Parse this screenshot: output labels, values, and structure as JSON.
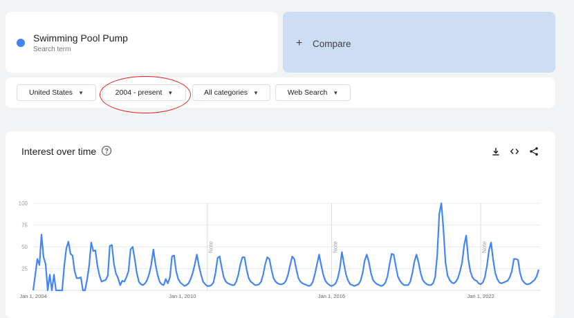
{
  "search_term": {
    "name": "Swimming Pool Pump",
    "subtitle": "Search term",
    "color": "#4285f4"
  },
  "compare": {
    "plus": "+",
    "label": "Compare"
  },
  "filters": {
    "region": "United States",
    "time_range": "2004 - present",
    "category": "All categories",
    "search_type": "Web Search"
  },
  "chart_section": {
    "title": "Interest over time",
    "icons": [
      "help-icon",
      "download-icon",
      "embed-icon",
      "share-icon"
    ]
  },
  "chart_data": {
    "type": "line",
    "title": "Interest over time",
    "xlabel": "",
    "ylabel": "",
    "ylim": [
      0,
      100
    ],
    "yticks": [
      25,
      50,
      75,
      100
    ],
    "x_range": [
      "2004-01",
      "2024-06"
    ],
    "grid": true,
    "x_tick_labels": [
      {
        "label": "Jan 1, 2004",
        "date": "2004-01"
      },
      {
        "label": "Jan 1, 2010",
        "date": "2010-01"
      },
      {
        "label": "Jan 1, 2016",
        "date": "2016-01"
      },
      {
        "label": "Jan 1, 2022",
        "date": "2022-01"
      }
    ],
    "notes": [
      {
        "label": "Note",
        "date": "2011-01"
      },
      {
        "label": "Note",
        "date": "2016-01"
      },
      {
        "label": "Note",
        "date": "2022-01"
      }
    ],
    "series": [
      {
        "name": "Swimming Pool Pump",
        "color": "#4285f4",
        "points": [
          [
            "2004-01",
            0
          ],
          [
            "2004-03",
            36
          ],
          [
            "2004-04",
            29
          ],
          [
            "2004-05",
            64
          ],
          [
            "2004-06",
            38
          ],
          [
            "2004-07",
            30
          ],
          [
            "2004-08",
            0
          ],
          [
            "2004-09",
            18
          ],
          [
            "2004-10",
            0
          ],
          [
            "2004-11",
            18
          ],
          [
            "2004-12",
            0
          ],
          [
            "2005-01",
            0
          ],
          [
            "2005-03",
            0
          ],
          [
            "2005-04",
            28
          ],
          [
            "2005-05",
            48
          ],
          [
            "2005-06",
            56
          ],
          [
            "2005-07",
            42
          ],
          [
            "2005-08",
            40
          ],
          [
            "2005-09",
            22
          ],
          [
            "2005-10",
            14
          ],
          [
            "2005-11",
            14
          ],
          [
            "2005-12",
            15
          ],
          [
            "2006-01",
            0
          ],
          [
            "2006-02",
            0
          ],
          [
            "2006-03",
            12
          ],
          [
            "2006-04",
            28
          ],
          [
            "2006-05",
            55
          ],
          [
            "2006-06",
            45
          ],
          [
            "2006-07",
            46
          ],
          [
            "2006-08",
            28
          ],
          [
            "2006-09",
            17
          ],
          [
            "2006-10",
            10
          ],
          [
            "2006-11",
            11
          ],
          [
            "2006-12",
            12
          ],
          [
            "2007-01",
            17
          ],
          [
            "2007-02",
            51
          ],
          [
            "2007-03",
            52
          ],
          [
            "2007-04",
            30
          ],
          [
            "2007-05",
            19
          ],
          [
            "2007-06",
            14
          ],
          [
            "2007-07",
            6
          ],
          [
            "2007-08",
            11
          ],
          [
            "2007-09",
            10
          ],
          [
            "2007-10",
            15
          ],
          [
            "2007-11",
            22
          ],
          [
            "2007-12",
            47
          ],
          [
            "2008-01",
            50
          ],
          [
            "2008-02",
            36
          ],
          [
            "2008-03",
            20
          ],
          [
            "2008-04",
            10
          ],
          [
            "2008-05",
            7
          ],
          [
            "2008-06",
            6
          ],
          [
            "2008-07",
            8
          ],
          [
            "2008-08",
            12
          ],
          [
            "2008-09",
            19
          ],
          [
            "2008-10",
            30
          ],
          [
            "2008-11",
            47
          ],
          [
            "2008-12",
            30
          ],
          [
            "2009-01",
            18
          ],
          [
            "2009-02",
            10
          ],
          [
            "2009-03",
            7
          ],
          [
            "2009-04",
            6
          ],
          [
            "2009-05",
            13
          ],
          [
            "2009-06",
            8
          ],
          [
            "2009-07",
            15
          ],
          [
            "2009-08",
            39
          ],
          [
            "2009-09",
            40
          ],
          [
            "2009-10",
            22
          ],
          [
            "2009-11",
            13
          ],
          [
            "2009-12",
            9
          ],
          [
            "2010-01",
            7
          ],
          [
            "2010-02",
            5
          ],
          [
            "2010-03",
            6
          ],
          [
            "2010-04",
            8
          ],
          [
            "2010-05",
            13
          ],
          [
            "2010-06",
            20
          ],
          [
            "2010-07",
            30
          ],
          [
            "2010-08",
            41
          ],
          [
            "2010-09",
            28
          ],
          [
            "2010-10",
            18
          ],
          [
            "2010-11",
            10
          ],
          [
            "2010-12",
            7
          ],
          [
            "2011-01",
            5
          ],
          [
            "2011-02",
            5
          ],
          [
            "2011-03",
            6
          ],
          [
            "2011-04",
            9
          ],
          [
            "2011-05",
            20
          ],
          [
            "2011-06",
            37
          ],
          [
            "2011-07",
            39
          ],
          [
            "2011-08",
            26
          ],
          [
            "2011-09",
            15
          ],
          [
            "2011-10",
            10
          ],
          [
            "2011-11",
            8
          ],
          [
            "2011-12",
            7
          ],
          [
            "2012-01",
            6
          ],
          [
            "2012-02",
            6
          ],
          [
            "2012-03",
            10
          ],
          [
            "2012-04",
            18
          ],
          [
            "2012-05",
            30
          ],
          [
            "2012-06",
            38
          ],
          [
            "2012-07",
            38
          ],
          [
            "2012-08",
            24
          ],
          [
            "2012-09",
            14
          ],
          [
            "2012-10",
            10
          ],
          [
            "2012-11",
            8
          ],
          [
            "2012-12",
            6
          ],
          [
            "2013-01",
            6
          ],
          [
            "2013-02",
            7
          ],
          [
            "2013-03",
            10
          ],
          [
            "2013-04",
            18
          ],
          [
            "2013-05",
            30
          ],
          [
            "2013-06",
            38
          ],
          [
            "2013-07",
            36
          ],
          [
            "2013-08",
            24
          ],
          [
            "2013-09",
            14
          ],
          [
            "2013-10",
            10
          ],
          [
            "2013-11",
            8
          ],
          [
            "2013-12",
            7
          ],
          [
            "2014-01",
            7
          ],
          [
            "2014-02",
            8
          ],
          [
            "2014-03",
            11
          ],
          [
            "2014-04",
            18
          ],
          [
            "2014-05",
            29
          ],
          [
            "2014-06",
            39
          ],
          [
            "2014-07",
            36
          ],
          [
            "2014-08",
            24
          ],
          [
            "2014-09",
            14
          ],
          [
            "2014-10",
            10
          ],
          [
            "2014-11",
            8
          ],
          [
            "2014-12",
            7
          ],
          [
            "2015-01",
            6
          ],
          [
            "2015-02",
            5
          ],
          [
            "2015-03",
            6
          ],
          [
            "2015-04",
            10
          ],
          [
            "2015-05",
            19
          ],
          [
            "2015-06",
            30
          ],
          [
            "2015-07",
            41
          ],
          [
            "2015-08",
            29
          ],
          [
            "2015-09",
            18
          ],
          [
            "2015-10",
            11
          ],
          [
            "2015-11",
            8
          ],
          [
            "2015-12",
            6
          ],
          [
            "2016-01",
            5
          ],
          [
            "2016-02",
            6
          ],
          [
            "2016-03",
            8
          ],
          [
            "2016-04",
            14
          ],
          [
            "2016-05",
            25
          ],
          [
            "2016-06",
            44
          ],
          [
            "2016-07",
            30
          ],
          [
            "2016-08",
            18
          ],
          [
            "2016-09",
            11
          ],
          [
            "2016-10",
            7
          ],
          [
            "2016-11",
            6
          ],
          [
            "2016-12",
            5
          ],
          [
            "2017-01",
            6
          ],
          [
            "2017-02",
            7
          ],
          [
            "2017-03",
            11
          ],
          [
            "2017-04",
            20
          ],
          [
            "2017-05",
            34
          ],
          [
            "2017-06",
            41
          ],
          [
            "2017-07",
            33
          ],
          [
            "2017-08",
            20
          ],
          [
            "2017-09",
            12
          ],
          [
            "2017-10",
            9
          ],
          [
            "2017-11",
            7
          ],
          [
            "2017-12",
            6
          ],
          [
            "2018-01",
            5
          ],
          [
            "2018-02",
            6
          ],
          [
            "2018-03",
            9
          ],
          [
            "2018-04",
            16
          ],
          [
            "2018-05",
            30
          ],
          [
            "2018-06",
            42
          ],
          [
            "2018-07",
            41
          ],
          [
            "2018-08",
            28
          ],
          [
            "2018-09",
            16
          ],
          [
            "2018-10",
            11
          ],
          [
            "2018-11",
            8
          ],
          [
            "2018-12",
            6
          ],
          [
            "2019-01",
            6
          ],
          [
            "2019-02",
            6
          ],
          [
            "2019-03",
            10
          ],
          [
            "2019-04",
            20
          ],
          [
            "2019-05",
            33
          ],
          [
            "2019-06",
            41
          ],
          [
            "2019-07",
            32
          ],
          [
            "2019-08",
            20
          ],
          [
            "2019-09",
            12
          ],
          [
            "2019-10",
            9
          ],
          [
            "2019-11",
            7
          ],
          [
            "2019-12",
            6
          ],
          [
            "2020-01",
            6
          ],
          [
            "2020-02",
            8
          ],
          [
            "2020-03",
            15
          ],
          [
            "2020-04",
            40
          ],
          [
            "2020-05",
            88
          ],
          [
            "2020-06",
            100
          ],
          [
            "2020-07",
            70
          ],
          [
            "2020-08",
            32
          ],
          [
            "2020-09",
            17
          ],
          [
            "2020-10",
            12
          ],
          [
            "2020-11",
            9
          ],
          [
            "2020-12",
            8
          ],
          [
            "2021-01",
            10
          ],
          [
            "2021-02",
            14
          ],
          [
            "2021-03",
            22
          ],
          [
            "2021-04",
            32
          ],
          [
            "2021-05",
            52
          ],
          [
            "2021-06",
            63
          ],
          [
            "2021-07",
            36
          ],
          [
            "2021-08",
            22
          ],
          [
            "2021-09",
            15
          ],
          [
            "2021-10",
            12
          ],
          [
            "2021-11",
            11
          ],
          [
            "2021-12",
            8
          ],
          [
            "2022-01",
            7
          ],
          [
            "2022-02",
            9
          ],
          [
            "2022-03",
            15
          ],
          [
            "2022-04",
            28
          ],
          [
            "2022-05",
            46
          ],
          [
            "2022-06",
            55
          ],
          [
            "2022-07",
            35
          ],
          [
            "2022-08",
            20
          ],
          [
            "2022-09",
            13
          ],
          [
            "2022-10",
            9
          ],
          [
            "2022-11",
            8
          ],
          [
            "2022-12",
            9
          ],
          [
            "2023-01",
            10
          ],
          [
            "2023-02",
            11
          ],
          [
            "2023-03",
            15
          ],
          [
            "2023-04",
            22
          ],
          [
            "2023-05",
            36
          ],
          [
            "2023-06",
            36
          ],
          [
            "2023-07",
            35
          ],
          [
            "2023-08",
            20
          ],
          [
            "2023-09",
            12
          ],
          [
            "2023-10",
            9
          ],
          [
            "2023-11",
            7
          ],
          [
            "2023-12",
            7
          ],
          [
            "2024-01",
            8
          ],
          [
            "2024-02",
            10
          ],
          [
            "2024-03",
            12
          ],
          [
            "2024-04",
            16
          ],
          [
            "2024-05",
            24
          ]
        ]
      }
    ]
  }
}
